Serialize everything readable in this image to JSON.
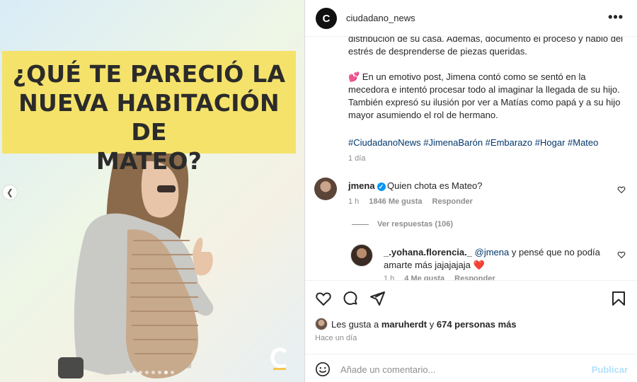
{
  "media": {
    "headline": "¿QUÉ TE PARECIÓ LA\nNUEVA HABITACIÓN DE\nMATEO?",
    "prev_icon": "chevron-left-icon",
    "dots_count": 8,
    "active_dot": 6
  },
  "post": {
    "username": "ciudadano_news",
    "avatar_letter": "C",
    "more_label": "•••",
    "caption": {
      "p1": "distribución de su casa. Además, documentó el proceso y habló del estrés de desprenderse de piezas queridas.",
      "p2": "💕 En un emotivo post, Jimena contó como se sentó en la mecedora e intentó procesar todo al imaginar la llegada de su hijo. También expresó su ilusión por ver a Matías como papá y a su hijo mayor asumiendo el rol de hermano."
    },
    "hashtags": "#CiudadanoNews #JimenaBarón #Embarazo #Hogar #Mateo",
    "caption_time": "1 día"
  },
  "comments": [
    {
      "username": "jmena",
      "verified": true,
      "text": "Quien chota es Mateo?",
      "time": "1 h",
      "likes": "1846 Me gusta",
      "reply": "Responder",
      "view_replies": "Ver respuestas (106)"
    },
    {
      "username": "_.yohana.florencia._",
      "mention": "@jmena",
      "text": " y pensé que no podía amarte más jajajajaja ❤️",
      "time": "1 h",
      "likes": "4 Me gusta",
      "reply": "Responder"
    }
  ],
  "footer": {
    "likes_prefix": "Les gusta a ",
    "likes_user": "maruherdt",
    "likes_mid": " y ",
    "likes_count": "674 personas más",
    "post_time": "Hace un día",
    "comment_placeholder": "Añade un comentario...",
    "publish_label": "Publicar"
  },
  "colors": {
    "accent": "#0095f6",
    "link": "#00376b",
    "muted": "#8e8e8e",
    "headline_bg": "#f5e26a",
    "like_red": "#ed4956"
  }
}
